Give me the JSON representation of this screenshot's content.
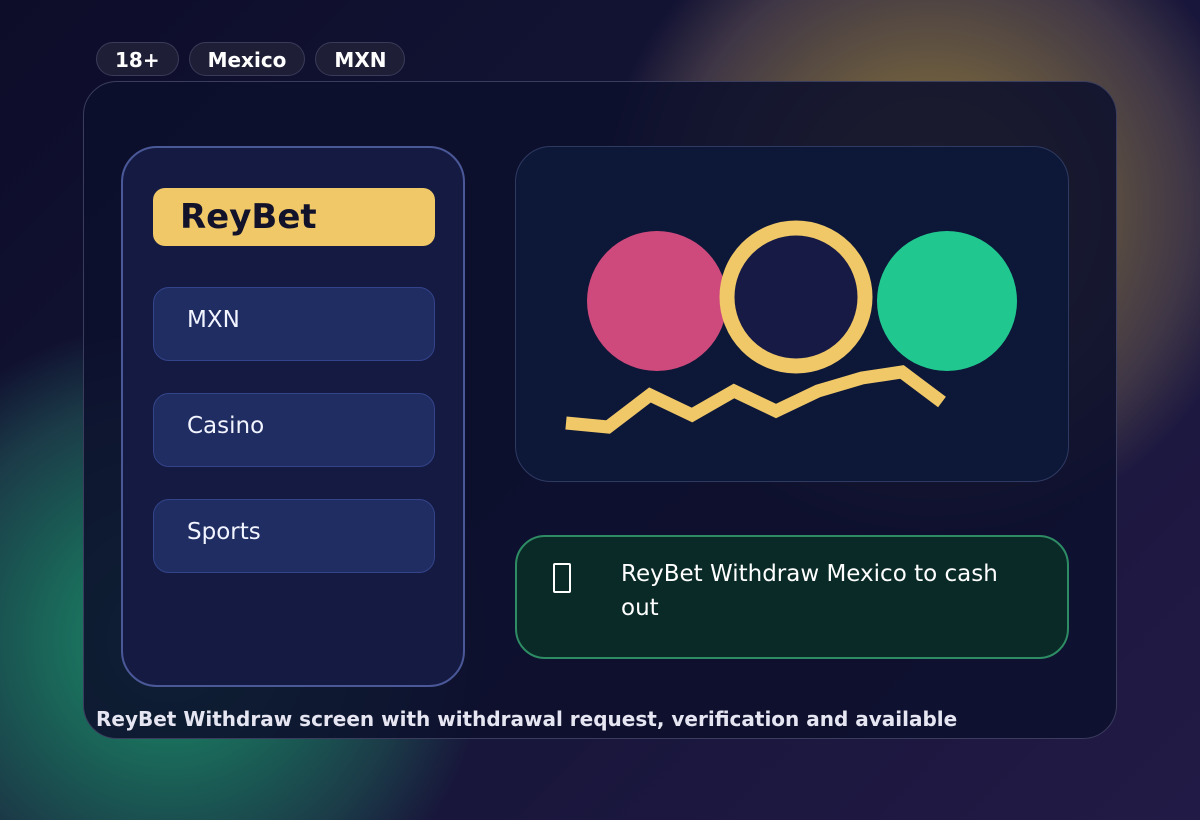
{
  "badges": [
    "18+",
    "Mexico",
    "MXN"
  ],
  "sidebar": {
    "brand": "ReyBet",
    "items": [
      {
        "label": "MXN"
      },
      {
        "label": "Casino"
      },
      {
        "label": "Sports"
      }
    ]
  },
  "notice": {
    "icon": "phone-icon",
    "text": "ReyBet Withdraw Mexico to cash out"
  },
  "caption": "ReyBet Withdraw screen with withdrawal request, verification and available",
  "colors": {
    "accent_gold": "#f0c868",
    "circle_pink": "#cf4a7c",
    "circle_green": "#20c890",
    "notice_border": "#2e8c64"
  }
}
